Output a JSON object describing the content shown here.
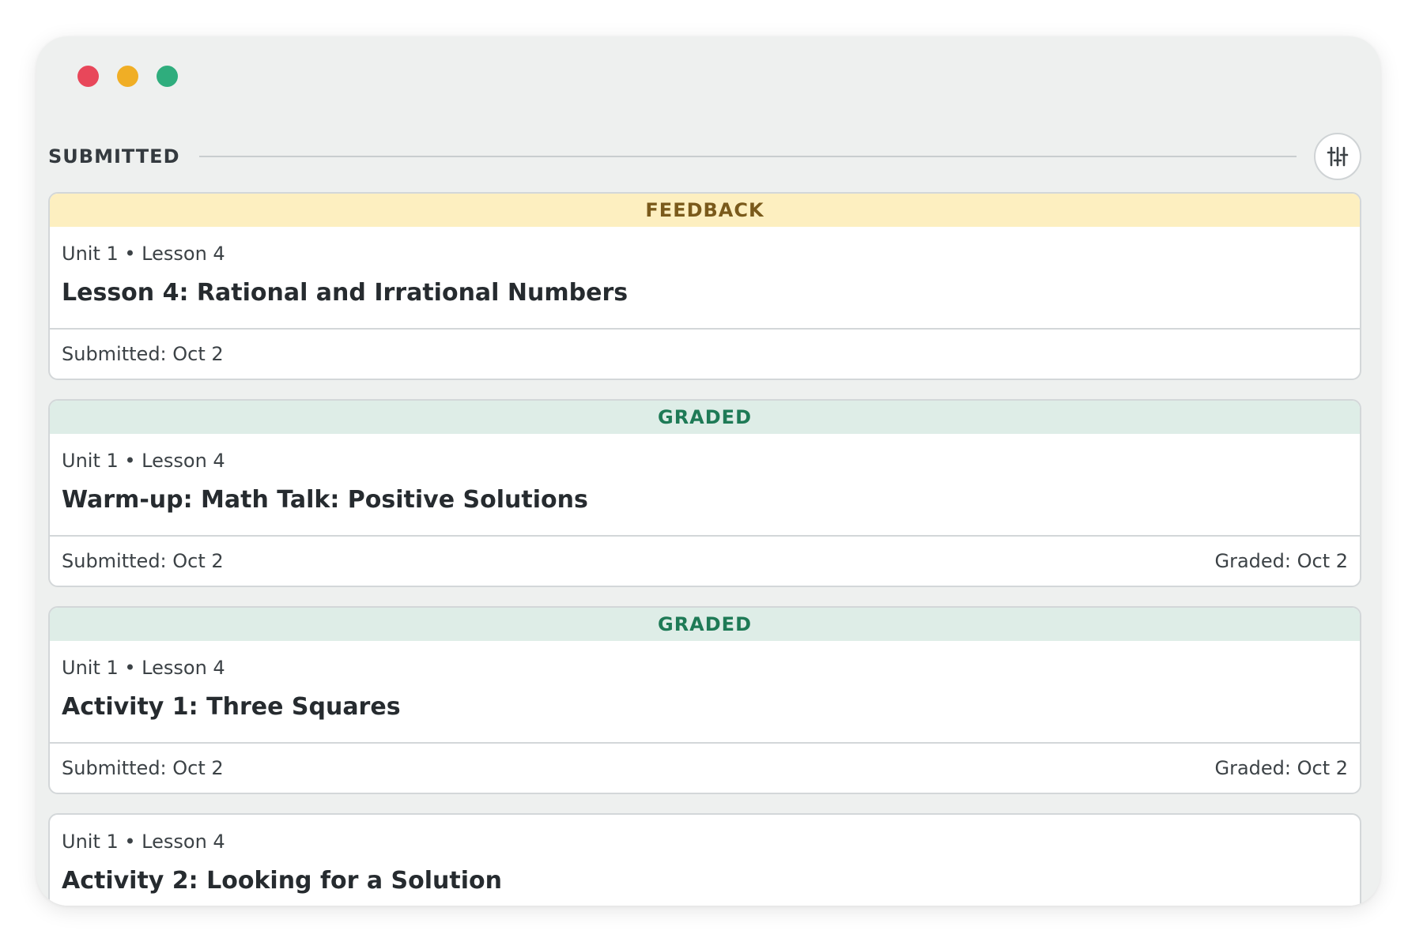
{
  "section": {
    "title": "SUBMITTED",
    "filter_icon": "sliders-icon"
  },
  "cards": [
    {
      "status": "FEEDBACK",
      "meta": "Unit 1 • Lesson 4",
      "title": "Lesson 4: Rational and Irrational Numbers",
      "submitted": "Submitted: Oct 2",
      "graded": ""
    },
    {
      "status": "GRADED",
      "meta": "Unit 1 • Lesson 4",
      "title": "Warm-up: Math Talk: Positive Solutions",
      "submitted": "Submitted: Oct 2",
      "graded": "Graded: Oct 2"
    },
    {
      "status": "GRADED",
      "meta": "Unit 1 • Lesson 4",
      "title": "Activity 1: Three Squares",
      "submitted": "Submitted: Oct 2",
      "graded": "Graded: Oct 2"
    },
    {
      "status": "",
      "meta": "Unit 1 • Lesson 4",
      "title": "Activity 2: Looking for a Solution",
      "submitted": "",
      "graded": ""
    }
  ],
  "colors": {
    "feedback_bg": "#fdefc0",
    "feedback_text": "#7a5a1b",
    "graded_bg": "#deede7",
    "graded_text": "#1e7a56"
  }
}
